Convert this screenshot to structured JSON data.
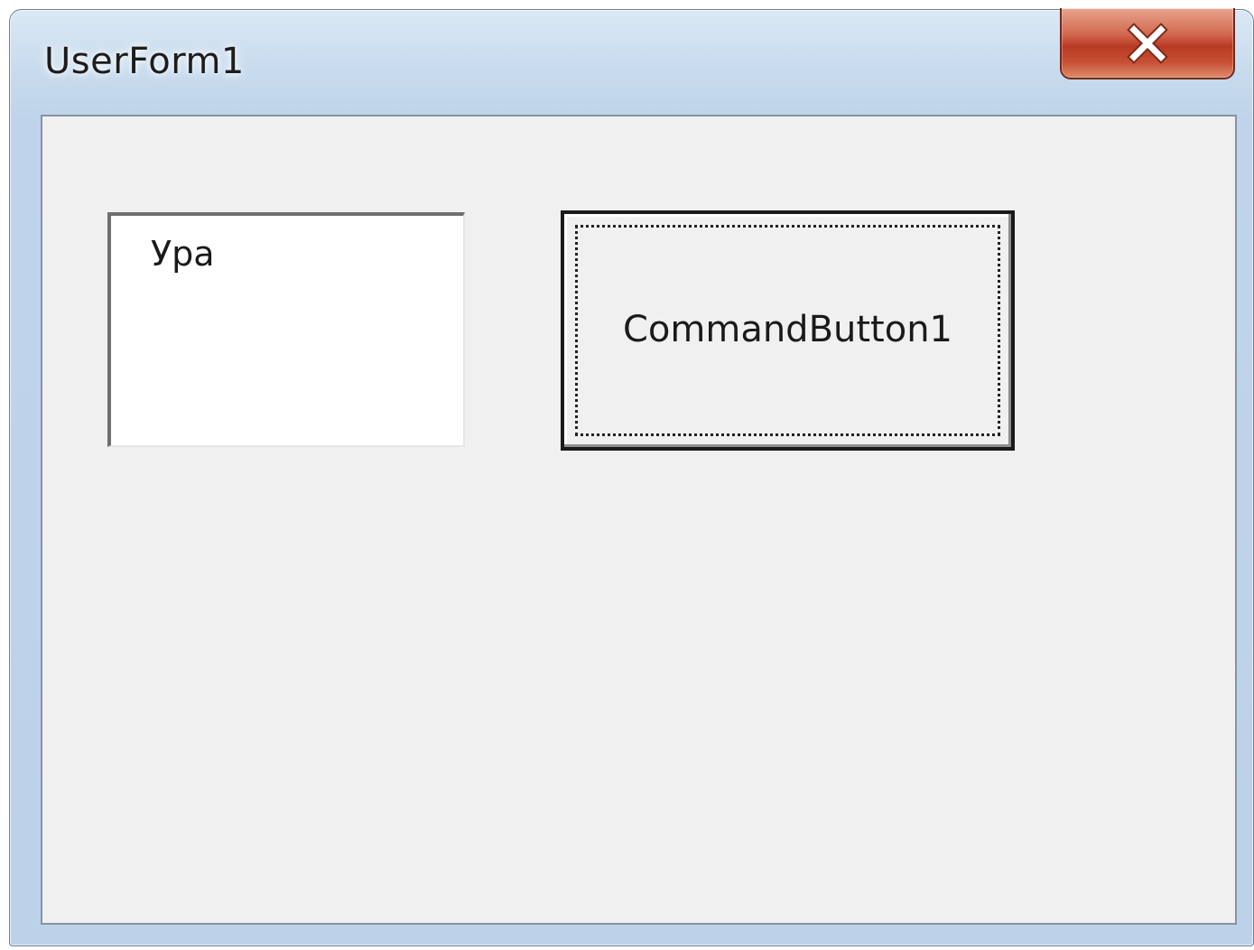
{
  "window": {
    "title": "UserForm1",
    "close_icon": "close-icon",
    "accent_color": "#c0442a"
  },
  "listbox": {
    "items": [
      "Ура"
    ]
  },
  "command_button": {
    "label": "CommandButton1",
    "focused": true
  }
}
